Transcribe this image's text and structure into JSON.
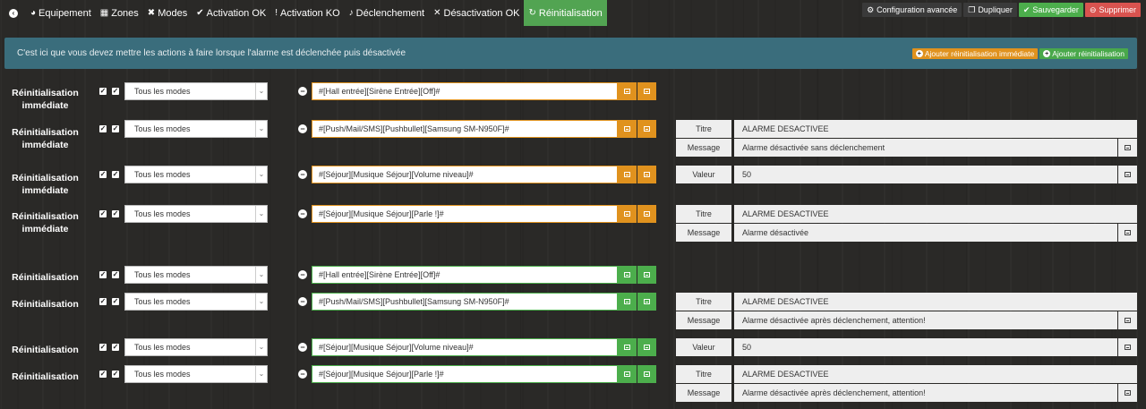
{
  "nav": {
    "items": [
      {
        "label": "Equipement"
      },
      {
        "label": "Zones"
      },
      {
        "label": "Modes"
      },
      {
        "label": "Activation OK"
      },
      {
        "label": "Activation KO"
      },
      {
        "label": "Déclenchement"
      },
      {
        "label": "Désactivation OK"
      },
      {
        "label": "Réinitialisation"
      }
    ],
    "active": "Réinitialisation"
  },
  "toolbar": {
    "config_label": "Configuration avancée",
    "duplicate_label": "Dupliquer",
    "save_label": "Sauvegarder",
    "delete_label": "Supprimer"
  },
  "info": {
    "message": "C'est ici que vous devez mettre les actions à faire lorsque l'alarme est déclenchée puis désactivée",
    "add_immediate_label": "Ajouter réinitialisation immédiate",
    "add_label": "Ajouter réinitialisation"
  },
  "rows": [
    {
      "label": "Réinitialisation immédiate",
      "mode": "Tous les modes",
      "command": "#[Hall entrée][Sirène Entrée][Off]#"
    },
    {
      "label": "Réinitialisation immédiate",
      "mode": "Tous les modes",
      "command": "#[Push/Mail/SMS][Pushbullet][Samsung SM-N950F]#",
      "params": [
        {
          "label": "Titre",
          "value": "ALARME DESACTIVEE"
        },
        {
          "label": "Message",
          "value": "Alarme désactivée sans déclenchement"
        }
      ]
    },
    {
      "label": "Réinitialisation immédiate",
      "mode": "Tous les modes",
      "command": "#[Séjour][Musique Séjour][Volume niveau]#",
      "params": [
        {
          "label": "Valeur",
          "value": "50"
        }
      ]
    },
    {
      "label": "Réinitialisation immédiate",
      "mode": "Tous les modes",
      "command": "#[Séjour][Musique Séjour][Parle !]#",
      "params": [
        {
          "label": "Titre",
          "value": "ALARME DESACTIVEE"
        },
        {
          "label": "Message",
          "value": "Alarme désactivée"
        }
      ]
    },
    {
      "label": "Réinitialisation",
      "mode": "Tous les modes",
      "command": "#[Hall entrée][Sirène Entrée][Off]#"
    },
    {
      "label": "Réinitialisation",
      "mode": "Tous les modes",
      "command": "#[Push/Mail/SMS][Pushbullet][Samsung SM-N950F]#",
      "params": [
        {
          "label": "Titre",
          "value": "ALARME DESACTIVEE"
        },
        {
          "label": "Message",
          "value": "Alarme désactivée après déclenchement, attention!"
        }
      ]
    },
    {
      "label": "Réinitialisation",
      "mode": "Tous les modes",
      "command": "#[Séjour][Musique Séjour][Volume niveau]#",
      "params": [
        {
          "label": "Valeur",
          "value": "50"
        }
      ]
    },
    {
      "label": "Réinitialisation",
      "mode": "Tous les modes",
      "command": "#[Séjour][Musique Séjour][Parle !]#",
      "params": [
        {
          "label": "Titre",
          "value": "ALARME DESACTIVEE"
        },
        {
          "label": "Message",
          "value": "Alarme désactivée après déclenchement, attention!"
        }
      ]
    }
  ],
  "colors": {
    "accent_orange": "#e0921e",
    "accent_green": "#4cae4c",
    "info_bg": "#3a6d7c",
    "danger": "#d9534f"
  }
}
